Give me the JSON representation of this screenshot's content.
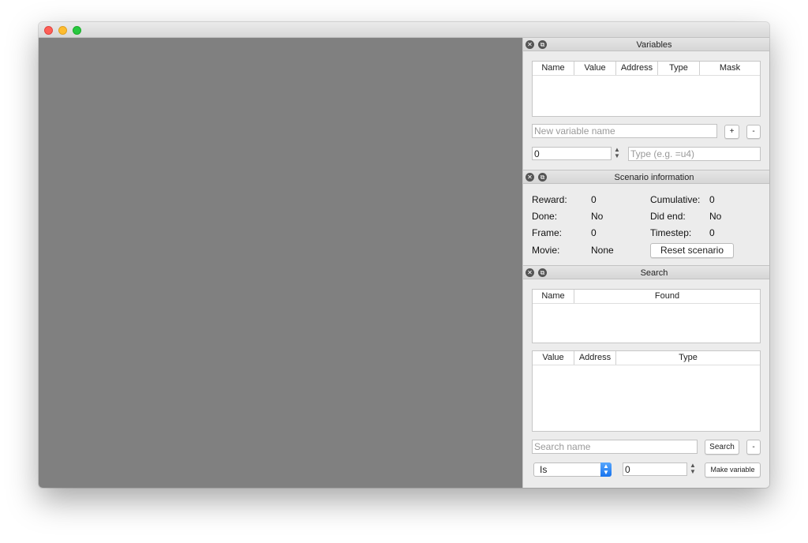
{
  "variables_panel": {
    "title": "Variables",
    "columns": [
      "Name",
      "Value",
      "Address",
      "Type",
      "Mask"
    ],
    "name_placeholder": "New variable name",
    "add_label": "+",
    "remove_label": "-",
    "value": "0",
    "type_placeholder": "Type (e.g. =u4)"
  },
  "scenario_panel": {
    "title": "Scenario information",
    "reward_label": "Reward:",
    "reward_value": "0",
    "cumulative_label": "Cumulative:",
    "cumulative_value": "0",
    "done_label": "Done:",
    "done_value": "No",
    "did_end_label": "Did end:",
    "did_end_value": "No",
    "frame_label": "Frame:",
    "frame_value": "0",
    "timestep_label": "Timestep:",
    "timestep_value": "0",
    "movie_label": "Movie:",
    "movie_value": "None",
    "reset_label": "Reset scenario"
  },
  "search_panel": {
    "title": "Search",
    "results_columns": [
      "Name",
      "Found"
    ],
    "values_columns": [
      "Value",
      "Address",
      "Type"
    ],
    "search_placeholder": "Search name",
    "search_label": "Search",
    "remove_label": "-",
    "mode_value": "Is",
    "value": "0",
    "make_variable_label": "Make variable"
  },
  "icons": {
    "close": "close-icon",
    "float": "float-icon",
    "stepper": "stepper-icon",
    "select_arrow": "chevron-updown-icon"
  }
}
